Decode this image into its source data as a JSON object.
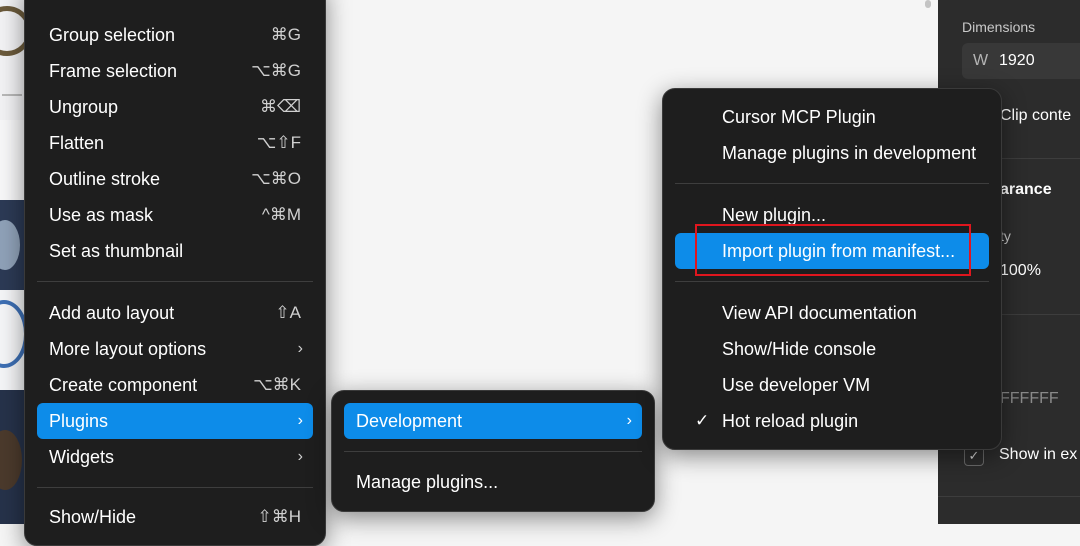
{
  "main_menu": {
    "items": [
      {
        "label": "Group selection",
        "shortcut": "⌘G"
      },
      {
        "label": "Frame selection",
        "shortcut": "⌥⌘G"
      },
      {
        "label": "Ungroup",
        "shortcut": "⌘⌫"
      },
      {
        "label": "Flatten",
        "shortcut": "⌥⇧F"
      },
      {
        "label": "Outline stroke",
        "shortcut": "⌥⌘O"
      },
      {
        "label": "Use as mask",
        "shortcut": "^⌘M"
      },
      {
        "label": "Set as thumbnail",
        "shortcut": ""
      },
      {
        "label": "Add auto layout",
        "shortcut": "⇧A"
      },
      {
        "label": "More layout options",
        "shortcut": "›"
      },
      {
        "label": "Create component",
        "shortcut": "⌥⌘K"
      },
      {
        "label": "Plugins",
        "shortcut": "›"
      },
      {
        "label": "Widgets",
        "shortcut": "›"
      },
      {
        "label": "Show/Hide",
        "shortcut": "⇧⌘H"
      }
    ]
  },
  "plugins_menu": {
    "items": [
      {
        "label": "Development",
        "arrow": "›"
      },
      {
        "label": "Manage plugins..."
      }
    ]
  },
  "dev_menu": {
    "items": [
      {
        "label": "Cursor MCP Plugin"
      },
      {
        "label": "Manage plugins in development"
      },
      {
        "label": "New plugin..."
      },
      {
        "label": "Import plugin from manifest..."
      },
      {
        "label": "View API documentation"
      },
      {
        "label": "Show/Hide console"
      },
      {
        "label": "Use developer VM"
      },
      {
        "label": "Hot reload plugin",
        "check": "✓"
      }
    ]
  },
  "right_panel": {
    "dimensions_label": "Dimensions",
    "width_prefix": "W",
    "width_value": "1920",
    "clip_content": "Clip conte",
    "appearance": "arance",
    "opacity_label": "ty",
    "opacity_value": "100%",
    "fill_value": "FFFFFF",
    "show_in_export": "Show in ex",
    "check_mark": "✓"
  },
  "colors": {
    "accent": "#0d8ce9",
    "menu_bg": "#1e1e1e",
    "panel_bg": "#2c2c2c",
    "highlight": "#e0161e"
  }
}
